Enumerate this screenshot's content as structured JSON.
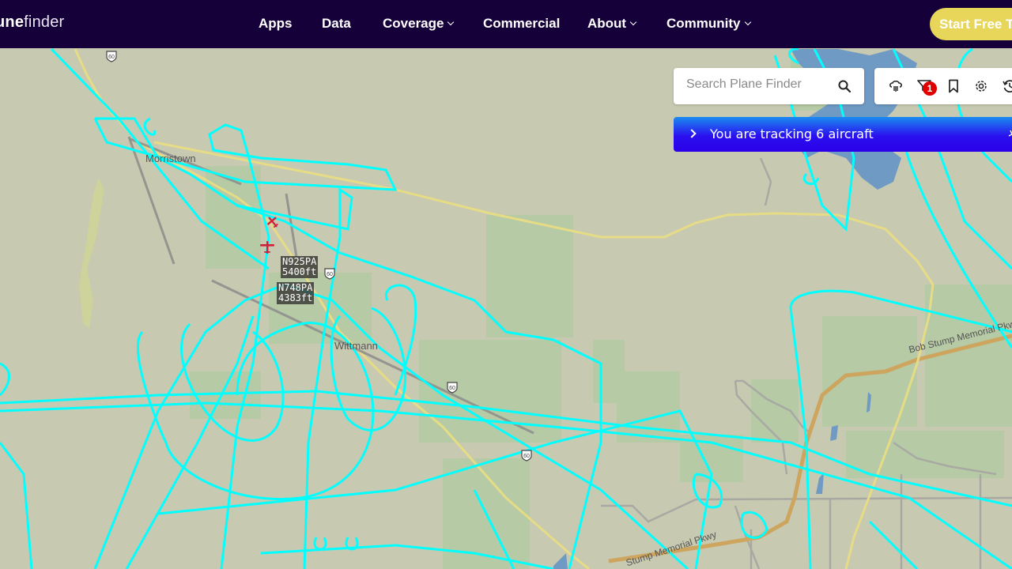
{
  "header": {
    "logo_bold": "ne",
    "logo_light": "finder",
    "logo_prefix": "u",
    "nav": [
      {
        "label": "Apps",
        "dropdown": false
      },
      {
        "label": "Data",
        "dropdown": false
      },
      {
        "label": "Coverage",
        "dropdown": true
      },
      {
        "label": "Commercial",
        "dropdown": false
      },
      {
        "label": "About",
        "dropdown": true
      },
      {
        "label": "Community",
        "dropdown": true
      }
    ],
    "cta_label": "Start Free Trial"
  },
  "search": {
    "placeholder": "Search Plane Finder",
    "value": ""
  },
  "toolbar": {
    "icons": [
      "weather-icon",
      "filter-icon",
      "bookmark-icon",
      "settings-icon",
      "history-icon"
    ],
    "filter_badge": "1"
  },
  "tracking_bar": {
    "text": "You are tracking 6 aircraft"
  },
  "aircraft": [
    {
      "callsign": "N925PA",
      "altitude": "5400ft"
    },
    {
      "callsign": "N748PA",
      "altitude": "4383ft"
    }
  ],
  "map": {
    "place_labels": [
      "Morristown",
      "Wittmann"
    ],
    "road_labels": [
      "Bob Stump Memorial Pkwy",
      "Stump Memorial Pkwy"
    ],
    "route_shield": "60",
    "track_color": "#00ffff",
    "highlight_color": "#e7d65a",
    "nav_bg": "#15003a"
  }
}
